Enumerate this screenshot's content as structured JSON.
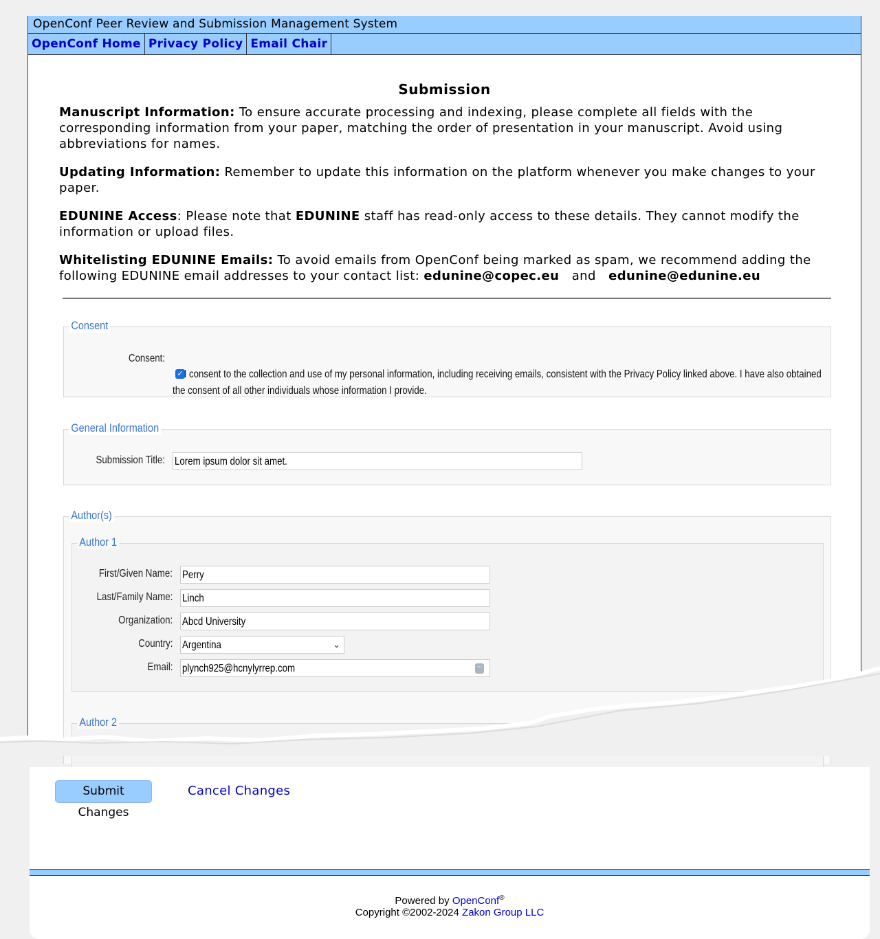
{
  "header": {
    "system_title": "OpenConf Peer Review and Submission Management System",
    "nav": [
      {
        "label": "OpenConf Home"
      },
      {
        "label": "Privacy Policy"
      },
      {
        "label": "Email Chair"
      }
    ]
  },
  "page": {
    "title": "Submission",
    "intro": {
      "manuscript_heading": "Manuscript Information:",
      "manuscript_text": " To ensure accurate processing and indexing, please complete all fields with the corresponding information from your paper, matching the order of presentation in your manuscript.  Avoid using abbreviations for names.",
      "updating_heading": "Updating Information:",
      "updating_text": " Remember to update this information on the platform whenever you make changes to your paper.",
      "access_heading": "EDUNINE Access",
      "access_text_1": ": Please note that ",
      "access_bold": "EDUNINE",
      "access_text_2": " staff has read-only access to these details. They cannot modify the information or upload files.",
      "whitelist_heading": "Whitelisting EDUNINE Emails:",
      "whitelist_text": " To avoid emails from OpenConf being marked as spam,  we recommend adding the following EDUNINE email addresses to your contact list: ",
      "email_1": "edunine@copec.eu",
      "and": "and",
      "email_2": "edunine@edunine.eu"
    }
  },
  "consent": {
    "legend": "Consent",
    "label": "Consent:",
    "checked": true,
    "text": "I consent to the collection and use of my personal information, including receiving emails, consistent with the Privacy Policy linked above. I have also obtained the consent of all other individuals whose information I provide."
  },
  "general": {
    "legend": "General Information",
    "title_label": "Submission Title:",
    "title_value": "Lorem ipsum dolor sit amet."
  },
  "authors": {
    "legend": "Author(s)",
    "author1": {
      "legend": "Author 1",
      "first_label": "First/Given Name:",
      "first_value": "Perry",
      "last_label": "Last/Family Name:",
      "last_value": "Linch",
      "org_label": "Organization:",
      "org_value": "Abcd University",
      "country_label": "Country:",
      "country_value": "Argentina",
      "email_label": "Email:",
      "email_value": "plynch925@hcnylyrrep.com"
    },
    "author2": {
      "legend": "Author 2"
    }
  },
  "actions": {
    "submit_label": "Submit Changes",
    "cancel_label": "Cancel Changes"
  },
  "footer": {
    "powered_by": "Powered by ",
    "openconf": "OpenConf",
    "registered": "®",
    "copyright": "Copyright ©2002-2024 ",
    "company": "Zakon Group LLC"
  },
  "colors": {
    "header_bg": "#99ccff",
    "link": "#0000cc",
    "legend": "#3a74d6",
    "checkbox": "#1a6fe0"
  }
}
